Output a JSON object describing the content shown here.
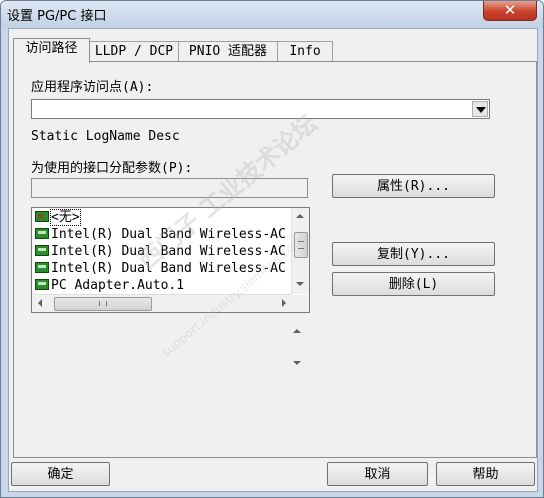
{
  "window": {
    "title": "设置 PG/PC 接口",
    "close_label": "✕"
  },
  "tabs": [
    {
      "label": "访问路径",
      "active": true
    },
    {
      "label": "LLDP / DCP",
      "active": false
    },
    {
      "label": "PNIO 适配器",
      "active": false
    },
    {
      "label": "Info",
      "active": false
    }
  ],
  "access_point": {
    "label": "应用程序访问点(A):",
    "value": ""
  },
  "logname": "Static LogName Desc",
  "interface": {
    "label": "为使用的接口分配参数(P):",
    "value": "",
    "properties_button": "属性(R)...",
    "copy_button": "复制(Y)...",
    "delete_button": "删除(L)",
    "items": [
      {
        "text": "<无>",
        "icon": "no-interface-icon",
        "selected": true
      },
      {
        "text": "Intel(R) Dual Band Wireless-AC",
        "icon": "network-adapter-icon",
        "selected": false
      },
      {
        "text": "Intel(R) Dual Band Wireless-AC",
        "icon": "network-adapter-icon",
        "selected": false
      },
      {
        "text": "Intel(R) Dual Band Wireless-AC",
        "icon": "network-adapter-icon",
        "selected": false
      },
      {
        "text": "PC Adapter.Auto.1",
        "icon": "network-adapter-icon",
        "selected": false
      }
    ]
  },
  "footer": {
    "ok": "确定",
    "cancel": "取消",
    "help": "帮助"
  },
  "watermark": {
    "text": "西门子 工业技术论坛",
    "url": "support.industry.siemens.com"
  }
}
